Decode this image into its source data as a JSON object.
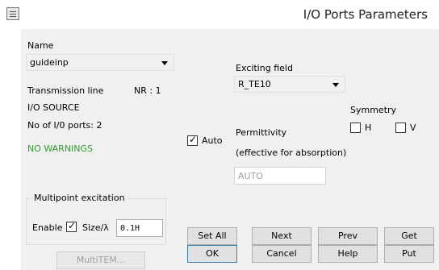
{
  "window": {
    "title": "I/O Ports Parameters"
  },
  "name_section": {
    "label": "Name",
    "value": "guideinp",
    "transmission_line": "Transmission line",
    "nr": "NR : 1",
    "io_source": "I/O SOURCE",
    "ports": "No of I/0 ports: 2",
    "warnings": "NO WARNINGS",
    "warnings_color": "#2e9e2e"
  },
  "exciting": {
    "label": "Exciting field",
    "value": "R_TE10"
  },
  "symmetry": {
    "label": "Symmetry",
    "h_label": "H",
    "v_label": "V",
    "h_checked": false,
    "v_checked": false
  },
  "auto": {
    "label": "Auto",
    "checked": true,
    "check_glyph": "✓"
  },
  "permittivity": {
    "label": "Permittivity",
    "note": "(effective for absorption)",
    "value": "AUTO"
  },
  "multipoint": {
    "legend": "Multipoint excitation",
    "enable_label": "Enable",
    "enable_checked": true,
    "check_glyph": "✓",
    "size_label": "Size/λ",
    "size_value": "0.1H",
    "multitem_label": "MultiTEM..."
  },
  "buttons": {
    "set_all": "Set All",
    "next": "Next",
    "prev": "Prev",
    "get": "Get",
    "ok": "OK",
    "cancel": "Cancel",
    "help": "Help",
    "put": "Put"
  }
}
